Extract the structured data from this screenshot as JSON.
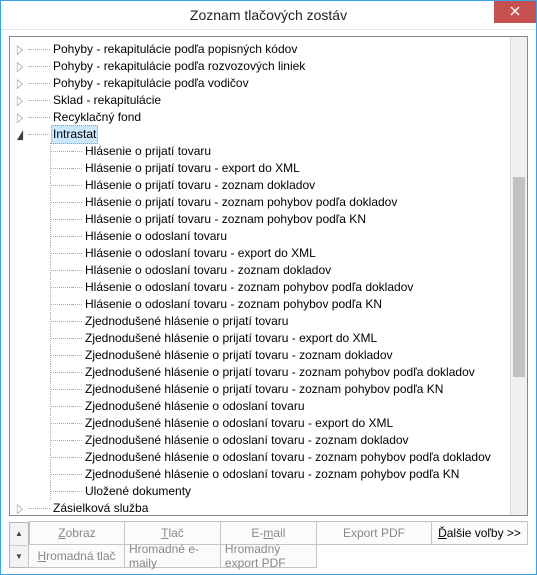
{
  "window": {
    "title": "Zoznam tlačových zostáv"
  },
  "tree": {
    "top": [
      "Pohyby - rekapitulácie podľa popisných kódov",
      "Pohyby - rekapitulácie podľa rozvozových liniek",
      "Pohyby - rekapitulácie podľa vodičov",
      "Sklad - rekapitulácie",
      "Recyklačný fond"
    ],
    "selected": "Intrastat",
    "children": [
      "Hlásenie o prijatí tovaru",
      "Hlásenie o prijatí tovaru - export do XML",
      "Hlásenie o prijatí tovaru - zoznam dokladov",
      "Hlásenie o prijatí tovaru - zoznam pohybov podľa dokladov",
      "Hlásenie o prijatí tovaru - zoznam pohybov podľa KN",
      "Hlásenie o odoslaní tovaru",
      "Hlásenie o odoslaní tovaru - export do XML",
      "Hlásenie o odoslaní tovaru - zoznam dokladov",
      "Hlásenie o odoslaní tovaru - zoznam pohybov podľa dokladov",
      "Hlásenie o odoslaní tovaru - zoznam pohybov podľa KN",
      "Zjednodušené hlásenie o prijatí tovaru",
      "Zjednodušené hlásenie o prijatí tovaru - export do XML",
      "Zjednodušené hlásenie o prijatí tovaru - zoznam dokladov",
      "Zjednodušené hlásenie o prijatí tovaru - zoznam pohybov podľa dokladov",
      "Zjednodušené hlásenie o prijatí tovaru - zoznam pohybov podľa KN",
      "Zjednodušené hlásenie o odoslaní tovaru",
      "Zjednodušené hlásenie o odoslaní tovaru - export do XML",
      "Zjednodušené hlásenie o odoslaní tovaru - zoznam dokladov",
      "Zjednodušené hlásenie o odoslaní tovaru - zoznam pohybov podľa dokladov",
      "Zjednodušené hlásenie o odoslaní tovaru - zoznam pohybov podľa KN",
      "Uložené dokumenty"
    ],
    "after": [
      "Zásielková služba"
    ]
  },
  "buttons": {
    "zobraz": "Zobraz",
    "tlac": "Tlač",
    "email": "E-mail",
    "exportpdf": "Export PDF",
    "dalsie": "Ďalšie voľby >>",
    "hromadnatlac": "Hromadná tlač",
    "hromadneemaily": "Hromadné e-maily",
    "hromadnyexport": "Hromadný export PDF"
  }
}
